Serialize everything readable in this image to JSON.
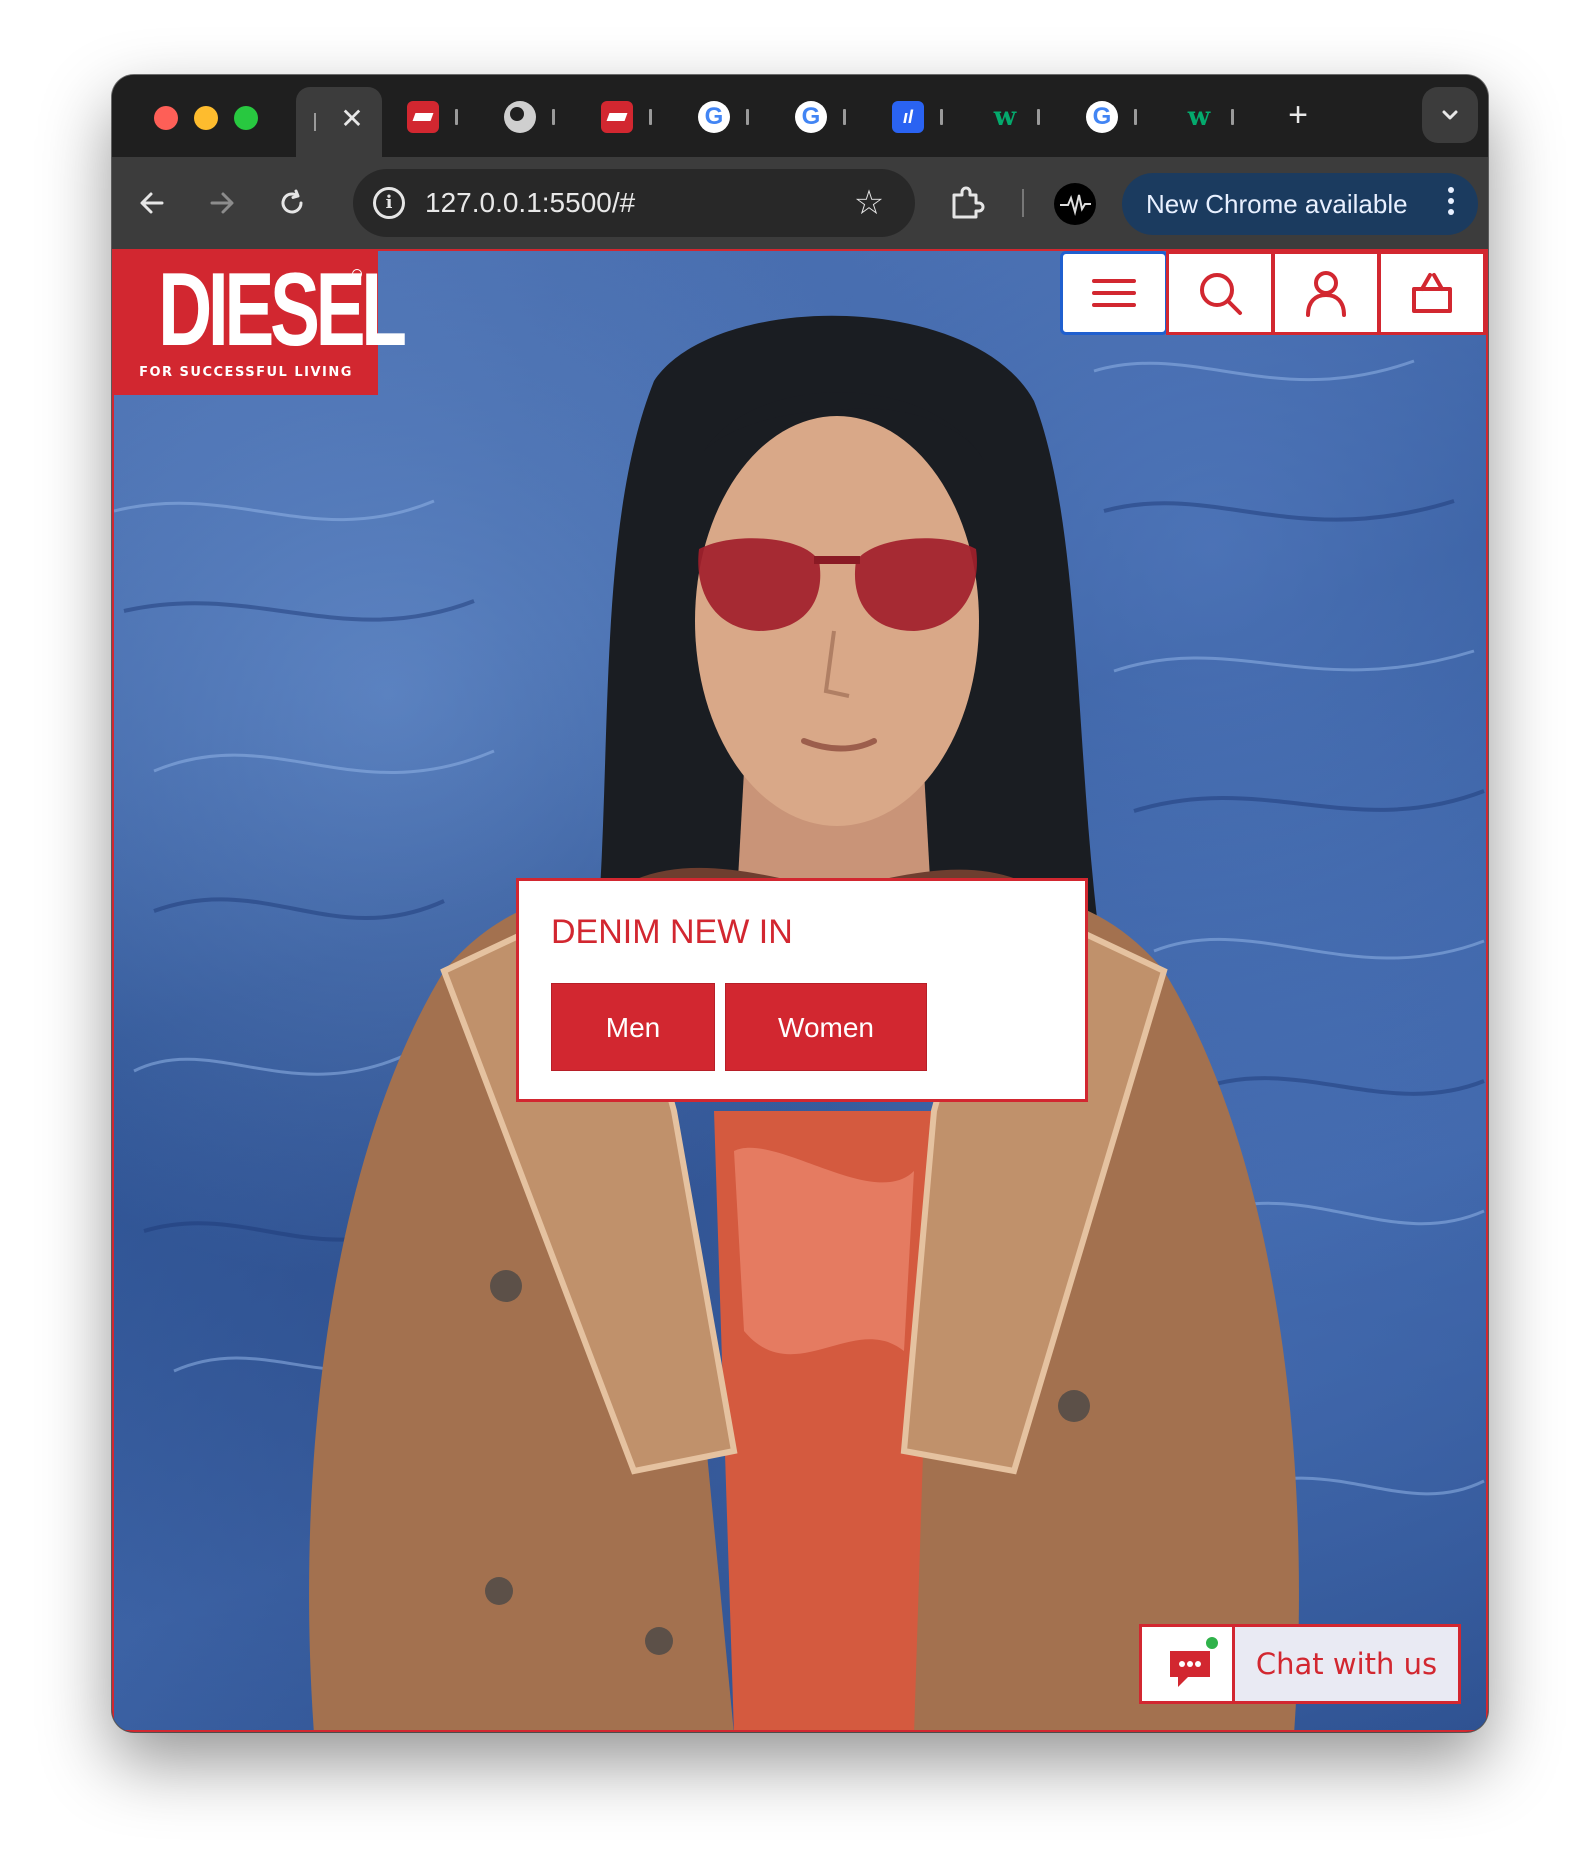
{
  "browser": {
    "tabs": [
      {
        "favicon": "diesel-logo-icon"
      },
      {
        "favicon": "globe-icon"
      },
      {
        "favicon": "diesel-logo-icon"
      },
      {
        "favicon": "google-icon"
      },
      {
        "favicon": "google-icon"
      },
      {
        "favicon": "analytics-icon"
      },
      {
        "favicon": "w3schools-icon"
      },
      {
        "favicon": "google-icon"
      },
      {
        "favicon": "w3schools-icon"
      }
    ],
    "new_tab_label": "+",
    "url": "127.0.0.1:5500/#",
    "update_label": "New Chrome available"
  },
  "site": {
    "brand": "DIESEL",
    "tagline": "FOR SUCCESSFUL LIVING",
    "colors": {
      "brand_red": "#d22730",
      "focus_blue": "#1f5fcf"
    },
    "header_icons": [
      "menu-icon",
      "search-icon",
      "account-icon",
      "basket-icon"
    ]
  },
  "promo": {
    "title": "DENIM NEW IN",
    "buttons": [
      "Men",
      "Women"
    ]
  },
  "chat": {
    "label": "Chat with us"
  }
}
